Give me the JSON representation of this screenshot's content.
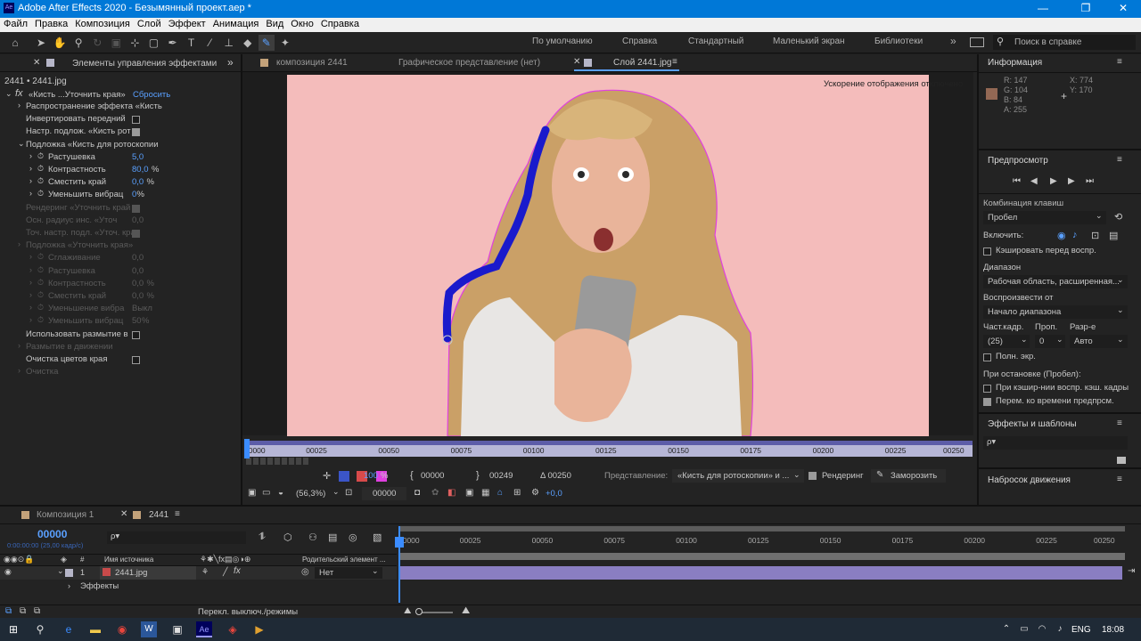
{
  "window": {
    "title": "Adobe After Effects 2020 - Безымянный проект.aep *",
    "minimize": "—",
    "maximize": "❐",
    "close": "✕"
  },
  "menu": [
    "Файл",
    "Правка",
    "Композиция",
    "Слой",
    "Эффект",
    "Анимация",
    "Вид",
    "Окно",
    "Справка"
  ],
  "workspaces": [
    "По умолчанию",
    "Справка",
    "Стандартный",
    "Маленький экран",
    "Библиотеки"
  ],
  "search_help": "Поиск в справке",
  "effects_panel": {
    "tab": "Элементы управления эффектами",
    "breadcrumb": "2441 • 2441.jpg",
    "effect_name": "«Кисть ...Уточнить края»",
    "reset": "Сбросить",
    "rows": [
      {
        "label": "Распространение эффекта «Кисть",
        "indent": 1,
        "arrow": true
      },
      {
        "label": "Инвертировать передний",
        "indent": 1,
        "checkbox": false
      },
      {
        "label": "Настр. подлож. «Кисть рот",
        "indent": 1,
        "checkbox": true
      },
      {
        "label": "Подложка «Кисть для ротоскопии",
        "indent": 1,
        "arrow": true,
        "open": true
      },
      {
        "label": "Растушевка",
        "indent": 2,
        "value": "5,0",
        "blue": true
      },
      {
        "label": "Контрастность",
        "indent": 2,
        "value": "80,0",
        "unit": "%",
        "blue": true
      },
      {
        "label": "Сместить край",
        "indent": 2,
        "value": "0,0",
        "unit": "%",
        "blue": true
      },
      {
        "label": "Уменьшить вибрац",
        "indent": 2,
        "value": "0",
        "unit": "%",
        "blue": true
      },
      {
        "label": "Рендеринг «Уточнить край",
        "indent": 1,
        "dim": true,
        "checkbox": true
      },
      {
        "label": "Осн. радиус инс. «Уточ",
        "indent": 1,
        "dim": true,
        "value": "0,0"
      },
      {
        "label": "Точ. настр. подл. «Уточ. края",
        "indent": 1,
        "dim": true,
        "checkbox": true
      },
      {
        "label": "Подложка «Уточнить края»",
        "indent": 1,
        "dim": true,
        "arrow": true
      },
      {
        "label": "Сглаживание",
        "indent": 2,
        "dim": true,
        "value": "0,0"
      },
      {
        "label": "Растушевка",
        "indent": 2,
        "dim": true,
        "value": "0,0"
      },
      {
        "label": "Контрастность",
        "indent": 2,
        "dim": true,
        "value": "0,0",
        "unit": "%"
      },
      {
        "label": "Сместить край",
        "indent": 2,
        "dim": true,
        "value": "0,0",
        "unit": "%"
      },
      {
        "label": "Уменьшение вибра",
        "indent": 2,
        "dim": true,
        "value": "Выкл"
      },
      {
        "label": "Уменьшить вибрац",
        "indent": 2,
        "dim": true,
        "value": "50",
        "unit": "%"
      },
      {
        "label": "Использовать размытие в",
        "indent": 1,
        "checkbox": false
      },
      {
        "label": "Размытие в движении",
        "indent": 1,
        "dim": true,
        "arrow": true
      },
      {
        "label": "Очистка цветов края",
        "indent": 1,
        "checkbox": false
      },
      {
        "label": "Очистка",
        "indent": 1,
        "dim": true,
        "arrow": true
      }
    ]
  },
  "viewer": {
    "tabs": [
      "композиция 2441",
      "Графическое представление (нет)",
      "Слой 2441.jpg"
    ],
    "notice": "Ускорение отображения отключено",
    "ruler": [
      "00000",
      "00025",
      "00050",
      "00075",
      "00100",
      "00125",
      "00150",
      "00175",
      "00200",
      "00225",
      "00250"
    ],
    "zoom": "100",
    "zoom_unit": "%",
    "in_point": "00000",
    "out_point": "00249",
    "duration": "Δ 00250",
    "view_label": "Представление:",
    "view_value": "«Кисть для ротоскопии» и ...",
    "render_label": "Рендеринг",
    "freeze": "Заморозить",
    "mag": "(56,3%)",
    "time": "00000",
    "exposure": "+0,0"
  },
  "info": {
    "title": "Информация",
    "r": "R:  147",
    "g": "G:  104",
    "b": "B:  84",
    "a": "A:  255",
    "x": "X:  774",
    "y": "Y:  170",
    "swatch": "#936854"
  },
  "preview": {
    "title": "Предпросмотр",
    "shortcut_label": "Комбинация клавиш",
    "shortcut": "Пробел",
    "include": "Включить:",
    "cache_before": "Кэшировать перед воспр.",
    "range_label": "Диапазон",
    "range": "Рабочая область, расширенная...",
    "play_from_label": "Воспроизвести от",
    "play_from": "Начало диапазона",
    "fps_label": "Част.кадр.",
    "skip_label": "Проп.",
    "res_label": "Разр-е",
    "fps": "(25)",
    "skip": "0",
    "res": "Авто",
    "full": "Полн. экр.",
    "on_stop": "При остановке (Пробел):",
    "on_stop_1": "При кэшир-нии воспр. кэш. кадры",
    "on_stop_2": "Перем. ко времени предпрсм."
  },
  "effects_templates": {
    "title": "Эффекты и шаблоны",
    "search": "ρ▾"
  },
  "motion_sketch": {
    "title": "Набросок движения"
  },
  "timeline": {
    "tabs": [
      "Композиция 1",
      "2441"
    ],
    "timecode": "00000",
    "timecode_sub": "0:00:00:00 (25,00 кадр/с)",
    "col_num": "#",
    "col_source": "Имя источника",
    "col_parent": "Родительский элемент ...",
    "layer_num": "1",
    "layer_name": "2441.jpg",
    "parent": "Нет",
    "effects": "Эффекты",
    "toggle": "Перекл. выключ./режимы",
    "ruler": [
      "00000",
      "00025",
      "00050",
      "00075",
      "00100",
      "00125",
      "00150",
      "00175",
      "00200",
      "00225",
      "00250"
    ]
  },
  "taskbar": {
    "lang": "ENG",
    "time": "18:08"
  }
}
